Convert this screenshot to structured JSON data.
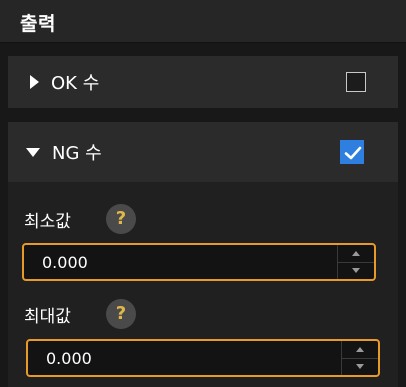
{
  "header": {
    "title": "출력"
  },
  "sections": {
    "ok": {
      "label": "OK 수",
      "checked": false
    },
    "ng": {
      "label": "NG 수",
      "checked": true,
      "min": {
        "label": "최소값",
        "value": "0.000"
      },
      "max": {
        "label": "최대값",
        "value": "0.000"
      },
      "help_glyph": "?"
    }
  },
  "colors": {
    "accent": "#e89a28",
    "checkbox_on": "#2f7fe0",
    "help_glyph": "#e0b84a"
  }
}
